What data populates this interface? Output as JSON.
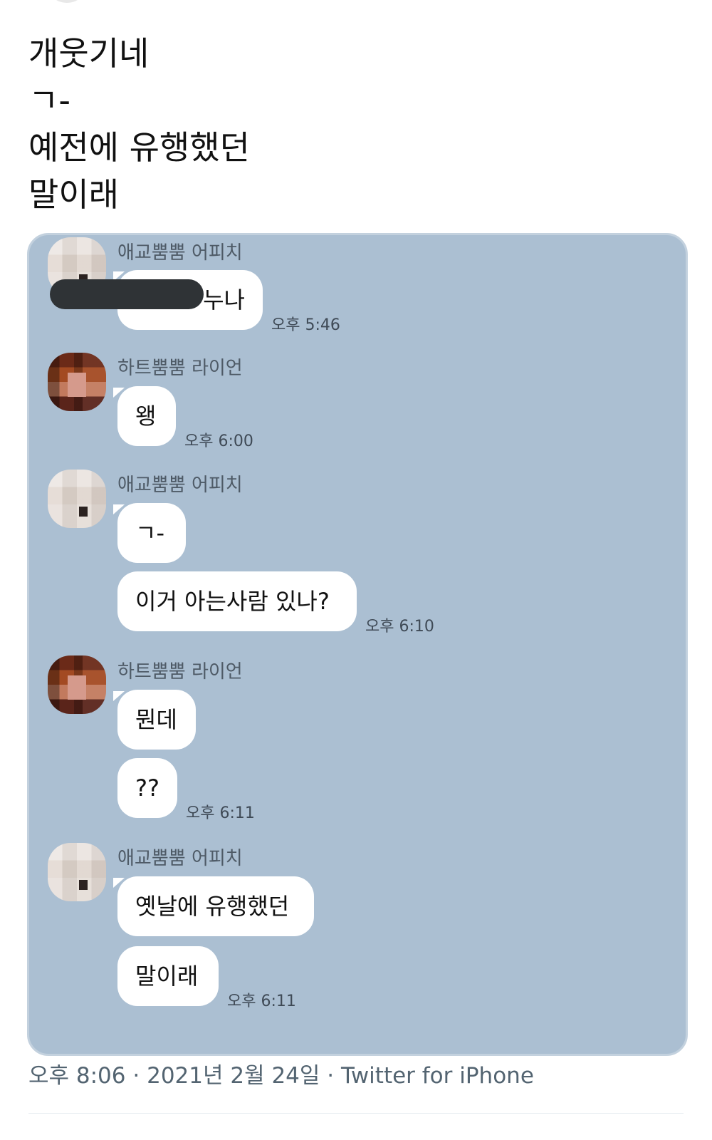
{
  "tweet": {
    "lines": [
      "개웃기네",
      "ㄱ-",
      "예전에 유행했던",
      "말이래"
    ],
    "meta": {
      "time": "오후 8:06",
      "date": "2021년 2월 24일",
      "source": "Twitter for iPhone",
      "separator": "·"
    }
  },
  "chat": {
    "background_color": "#abbfd2",
    "groups": [
      {
        "sender": "애교뿜뿜 어피치",
        "messages": [
          "누나"
        ],
        "time": "오후 5:46",
        "redacted_prefix": true
      },
      {
        "sender": "하트뿜뿜 라이언",
        "messages": [
          "왱"
        ],
        "time": "오후 6:00"
      },
      {
        "sender": "애교뿜뿜 어피치",
        "messages": [
          "ㄱ-",
          "이거 아는사람 있나?"
        ],
        "time": "오후 6:10"
      },
      {
        "sender": "하트뿜뿜 라이언",
        "messages": [
          "뭔데",
          "??"
        ],
        "time": "오후 6:11"
      },
      {
        "sender": "애교뿜뿜 어피치",
        "messages": [
          "옛날에 유행했던",
          "말이래"
        ],
        "time": "오후 6:11"
      }
    ]
  }
}
